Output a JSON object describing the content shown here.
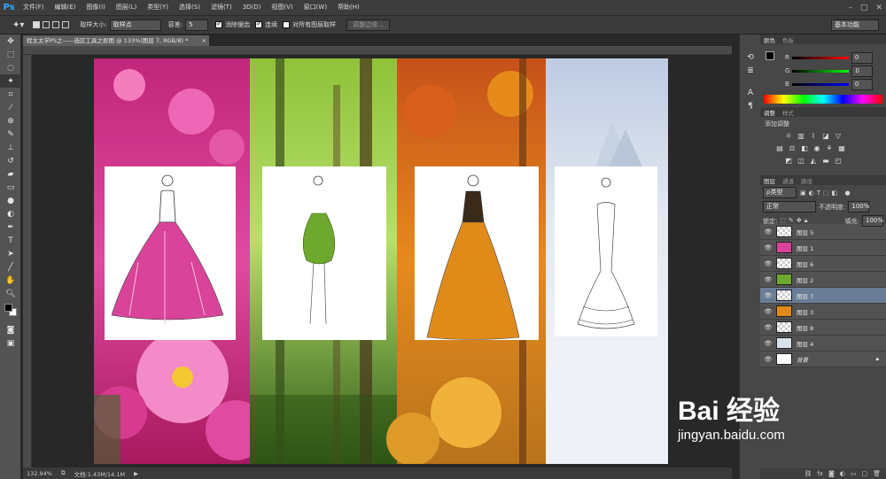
{
  "app": {
    "logo": "Ps",
    "menu": [
      "文件(F)",
      "编辑(E)",
      "图像(I)",
      "图层(L)",
      "类型(Y)",
      "选择(S)",
      "滤镜(T)",
      "3D(D)",
      "视图(V)",
      "窗口(W)",
      "帮助(H)"
    ]
  },
  "options": {
    "sample_size_label": "取样大小:",
    "sample_size_value": "取样点",
    "tolerance_label": "容差:",
    "tolerance_value": "5",
    "antialias_label": "消除锯齿",
    "contiguous_label": "连续",
    "sample_all_label": "对所有图层取样",
    "refine_edge_label": "调整边缘...",
    "workspace": "基本功能"
  },
  "document": {
    "tab_title": "程太太学PS之——选区工具之抠图 @ 133%(图层 7, RGB/8) *"
  },
  "status": {
    "zoom": "132.94%",
    "doc_info": "文档:1.43M/14.1M"
  },
  "color_panel": {
    "tabs": [
      "颜色",
      "色板"
    ],
    "r_label": "R",
    "g_label": "G",
    "b_label": "B",
    "r": "0",
    "g": "0",
    "b": "0"
  },
  "adjust_panel": {
    "tabs": [
      "调整",
      "样式"
    ],
    "title": "添加调整"
  },
  "layers_panel": {
    "tabs": [
      "图层",
      "通道",
      "路径"
    ],
    "filter": "ρ类型",
    "blend_mode": "正常",
    "opacity_label": "不透明度:",
    "opacity": "100%",
    "lock_label": "锁定:",
    "fill_label": "填充:",
    "fill": "100%",
    "layers": [
      {
        "name": "图层 5",
        "selected": false
      },
      {
        "name": "图层 1",
        "selected": false
      },
      {
        "name": "图层 6",
        "selected": false
      },
      {
        "name": "图层 2",
        "selected": false
      },
      {
        "name": "图层 7",
        "selected": true
      },
      {
        "name": "图层 3",
        "selected": false
      },
      {
        "name": "图层 8",
        "selected": false
      },
      {
        "name": "图层 4",
        "selected": false
      },
      {
        "name": "背景",
        "selected": false
      }
    ]
  },
  "watermark": {
    "line1": "Bai 经验",
    "line2": "jingyan.baidu.com"
  }
}
